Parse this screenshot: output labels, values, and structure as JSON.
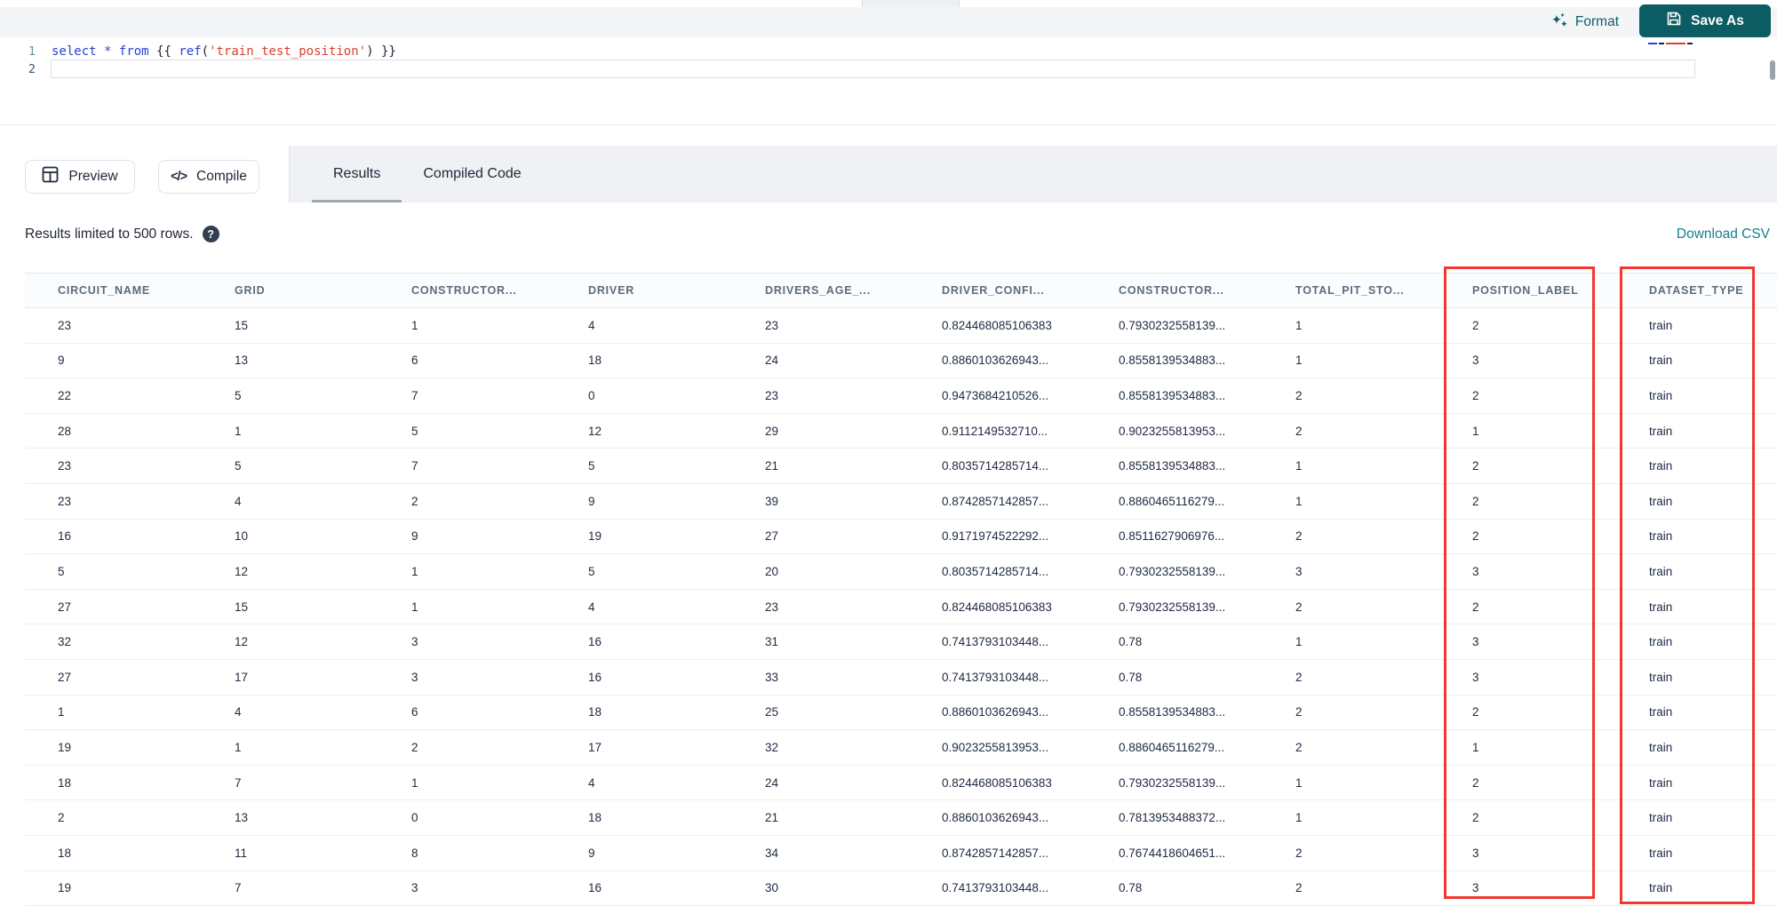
{
  "colors": {
    "accent_teal": "#0b5d63",
    "link_teal": "#15808d",
    "highlight_red": "#f0392e"
  },
  "toolbar": {
    "format_label": "Format",
    "save_as_label": "Save As"
  },
  "editor": {
    "lines": [
      {
        "number": "1",
        "tokens": [
          [
            "kw",
            "select"
          ],
          [
            "pl",
            " "
          ],
          [
            "op",
            "*"
          ],
          [
            "pl",
            " "
          ],
          [
            "kw",
            "from"
          ],
          [
            "pl",
            " "
          ],
          [
            "br",
            "{{"
          ],
          [
            "pl",
            " "
          ],
          [
            "fn",
            "ref"
          ],
          [
            "pn",
            "("
          ],
          [
            "str",
            "'train_test_position'"
          ],
          [
            "pn",
            ")"
          ],
          [
            "pl",
            " "
          ],
          [
            "br",
            "}}"
          ]
        ]
      },
      {
        "number": "2",
        "tokens": []
      }
    ]
  },
  "actions": {
    "preview_label": "Preview",
    "compile_label": "Compile",
    "compile_glyph": "</>"
  },
  "tabs": [
    {
      "label": "Results",
      "active": true
    },
    {
      "label": "Compiled Code",
      "active": false
    }
  ],
  "results": {
    "limit_text": "Results limited to 500 rows.",
    "help_glyph": "?",
    "download_csv_label": "Download CSV"
  },
  "table": {
    "columns": [
      "CIRCUIT_NAME",
      "GRID",
      "CONSTRUCTOR...",
      "DRIVER",
      "DRIVERS_AGE_...",
      "DRIVER_CONFI...",
      "CONSTRUCTOR...",
      "TOTAL_PIT_STO...",
      "POSITION_LABEL",
      "DATASET_TYPE"
    ],
    "highlighted_columns": [
      "POSITION_LABEL",
      "DATASET_TYPE"
    ],
    "rows": [
      [
        "23",
        "15",
        "1",
        "4",
        "23",
        "0.824468085106383",
        "0.7930232558139...",
        "1",
        "2",
        "train"
      ],
      [
        "9",
        "13",
        "6",
        "18",
        "24",
        "0.8860103626943...",
        "0.8558139534883...",
        "1",
        "3",
        "train"
      ],
      [
        "22",
        "5",
        "7",
        "0",
        "23",
        "0.9473684210526...",
        "0.8558139534883...",
        "2",
        "2",
        "train"
      ],
      [
        "28",
        "1",
        "5",
        "12",
        "29",
        "0.9112149532710...",
        "0.9023255813953...",
        "2",
        "1",
        "train"
      ],
      [
        "23",
        "5",
        "7",
        "5",
        "21",
        "0.8035714285714...",
        "0.8558139534883...",
        "1",
        "2",
        "train"
      ],
      [
        "23",
        "4",
        "2",
        "9",
        "39",
        "0.8742857142857...",
        "0.8860465116279...",
        "1",
        "2",
        "train"
      ],
      [
        "16",
        "10",
        "9",
        "19",
        "27",
        "0.9171974522292...",
        "0.8511627906976...",
        "2",
        "2",
        "train"
      ],
      [
        "5",
        "12",
        "1",
        "5",
        "20",
        "0.8035714285714...",
        "0.7930232558139...",
        "3",
        "3",
        "train"
      ],
      [
        "27",
        "15",
        "1",
        "4",
        "23",
        "0.824468085106383",
        "0.7930232558139...",
        "2",
        "2",
        "train"
      ],
      [
        "32",
        "12",
        "3",
        "16",
        "31",
        "0.7413793103448...",
        "0.78",
        "1",
        "3",
        "train"
      ],
      [
        "27",
        "17",
        "3",
        "16",
        "33",
        "0.7413793103448...",
        "0.78",
        "2",
        "3",
        "train"
      ],
      [
        "1",
        "4",
        "6",
        "18",
        "25",
        "0.8860103626943...",
        "0.8558139534883...",
        "2",
        "2",
        "train"
      ],
      [
        "19",
        "1",
        "2",
        "17",
        "32",
        "0.9023255813953...",
        "0.8860465116279...",
        "2",
        "1",
        "train"
      ],
      [
        "18",
        "7",
        "1",
        "4",
        "24",
        "0.824468085106383",
        "0.7930232558139...",
        "1",
        "2",
        "train"
      ],
      [
        "2",
        "13",
        "0",
        "18",
        "21",
        "0.8860103626943...",
        "0.7813953488372...",
        "1",
        "2",
        "train"
      ],
      [
        "18",
        "11",
        "8",
        "9",
        "34",
        "0.8742857142857...",
        "0.7674418604651...",
        "2",
        "3",
        "train"
      ],
      [
        "19",
        "7",
        "3",
        "16",
        "30",
        "0.7413793103448...",
        "0.78",
        "2",
        "3",
        "train"
      ]
    ]
  }
}
